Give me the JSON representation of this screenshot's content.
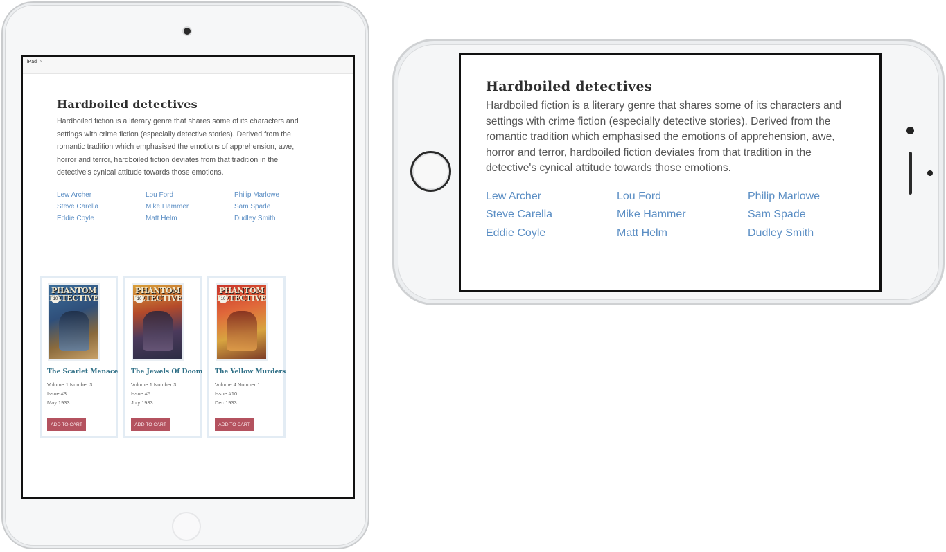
{
  "ipad": {
    "status_label": "iPad",
    "title": "Hardboiled detectives",
    "description": "Hardboiled fiction is a literary genre that shares some of its characters and settings with crime fiction (especially detective stories). Derived from the romantic tradition which emphasised the emotions of apprehension, awe, horror and terror, hardboiled fiction deviates from that tradition in the detective's cynical attitude towards those emotions.",
    "links": [
      "Lew Archer",
      "Lou Ford",
      "Philip Marlowe",
      "Steve Carella",
      "Mike Hammer",
      "Sam Spade",
      "Eddie Coyle",
      "Matt Helm",
      "Dudley Smith"
    ],
    "products": [
      {
        "cover_title": "PHANTOM DETECTIVE",
        "title": "The Scarlet Menace",
        "volume": "Volume 1 Number 3",
        "issue": "Issue #3",
        "date": "May 1933",
        "button": "ADD TO CART"
      },
      {
        "cover_title": "PHANTOM DETECTIVE",
        "title": "The Jewels Of Doom",
        "volume": "Volume 1 Number 3",
        "issue": "Issue #5",
        "date": "July 1933",
        "button": "ADD TO CART"
      },
      {
        "cover_title": "PHANTOM DETECTIVE",
        "title": "The Yellow Murders",
        "volume": "Volume 4 Number 1",
        "issue": "Issue #10",
        "date": "Dec 1933",
        "button": "ADD TO CART"
      }
    ]
  },
  "iphone": {
    "title": "Hardboiled detectives",
    "description": "Hardboiled fiction is a literary genre that shares some of its characters and settings with crime fiction (especially detective stories). Derived from the romantic tradition which emphasised the emotions of apprehension, awe, horror and terror, hardboiled fiction deviates from that tradition in the detective's cynical attitude towards those emotions.",
    "links": [
      "Lew Archer",
      "Lou Ford",
      "Philip Marlowe",
      "Steve Carella",
      "Mike Hammer",
      "Sam Spade",
      "Eddie Coyle",
      "Matt Helm",
      "Dudley Smith"
    ]
  },
  "colors": {
    "link": "#5b8ec4",
    "card_title": "#2f6f86",
    "cart_button": "#b4525f"
  }
}
